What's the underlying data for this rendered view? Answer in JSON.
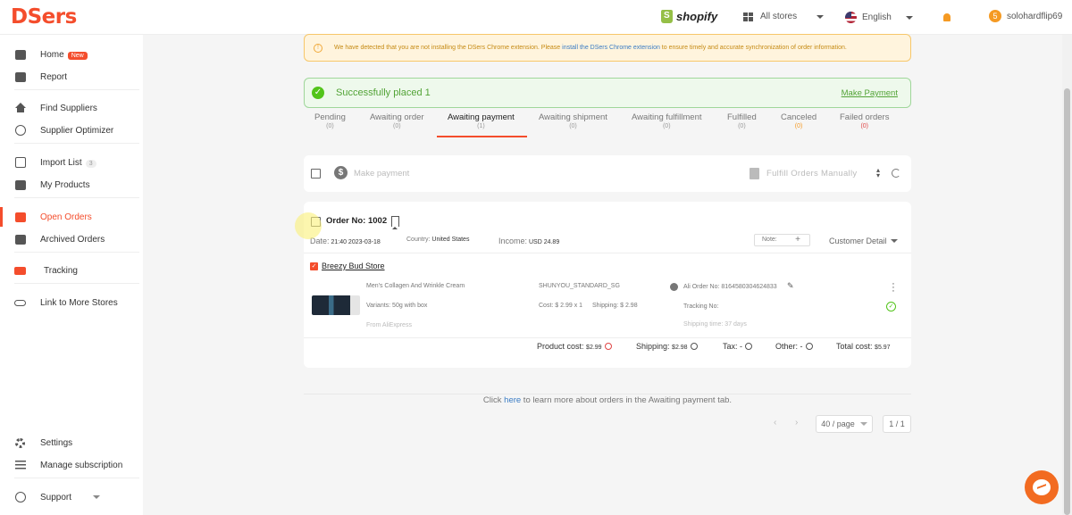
{
  "app": {
    "logo": "DSers",
    "platform": "shopify",
    "store_selector": "All stores",
    "language": "English",
    "user_badge": "5",
    "user_name": "solohardflip69"
  },
  "sidebar": {
    "items": [
      {
        "label": "Home",
        "badge": "New"
      },
      {
        "label": "Report"
      },
      {
        "label": "Find Suppliers"
      },
      {
        "label": "Supplier Optimizer"
      },
      {
        "label": "Import List",
        "badge": "3"
      },
      {
        "label": "My Products"
      },
      {
        "label": "Open Orders"
      },
      {
        "label": "Archived Orders"
      },
      {
        "label": "Tracking"
      },
      {
        "label": "Link to More Stores"
      },
      {
        "label": "Settings"
      },
      {
        "label": "Manage subscription"
      },
      {
        "label": "Support"
      }
    ]
  },
  "warning": {
    "text_before": "We have detected that you are not installing the DSers Chrome extension. Please ",
    "link": "install the DSers Chrome extension",
    "text_after": " to ensure timely and accurate synchronization of order information."
  },
  "success": {
    "message": "Successfully placed 1",
    "action": "Make Payment"
  },
  "tabs": [
    {
      "label": "Pending",
      "count": "(0)"
    },
    {
      "label": "Awaiting order",
      "count": "(0)"
    },
    {
      "label": "Awaiting payment",
      "count": "(1)"
    },
    {
      "label": "Awaiting shipment",
      "count": "(0)"
    },
    {
      "label": "Awaiting fulfillment",
      "count": "(0)"
    },
    {
      "label": "Fulfilled",
      "count": "(0)"
    },
    {
      "label": "Canceled",
      "count": "(0)"
    },
    {
      "label": "Failed orders",
      "count": "(0)"
    }
  ],
  "toolbar": {
    "make_payment": "Make payment",
    "fulfill_manually": "Fulfill Orders Manually"
  },
  "order": {
    "number": "Order No: 1002",
    "date_label": "Date:",
    "date": "21:40 2023-03-18",
    "country_label": "Country:",
    "country": "United States",
    "income_label": "Income:",
    "income": "USD 24.89",
    "note_label": "Note:",
    "note_add": "+",
    "customer_detail": "Customer Detail",
    "store": "Breezy Bud Store",
    "product_title": "Men's Collagen And Wrinkle Cream",
    "variant": "Variants: 50g with box",
    "source": "From AliExpress",
    "shipping_method": "SHUNYOU_STANDARD_SG",
    "cost_line": "Cost: $ 2.99 x 1",
    "shipping_line": "Shipping: $ 2.98",
    "ali_order": "Ali Order No: 8164580304624833",
    "tracking": "Tracking No:",
    "shipping_time": "Shipping time: 37 days",
    "totals": {
      "product_cost_label": "Product cost:",
      "product_cost": "$2.99",
      "shipping_label": "Shipping:",
      "shipping": "$2.98",
      "tax_label": "Tax:",
      "tax": "-",
      "other_label": "Other:",
      "other": "-",
      "total_label": "Total cost:",
      "total": "$5.97"
    }
  },
  "help": {
    "before": "Click ",
    "link": "here",
    "after": " to learn more about orders in the Awaiting payment tab."
  },
  "pagination": {
    "page_size": "40 / page",
    "page": "1 / 1"
  },
  "colors": {
    "brand": "#f44d2c",
    "success": "#52c41a",
    "warning_bg": "#fff4dd"
  }
}
